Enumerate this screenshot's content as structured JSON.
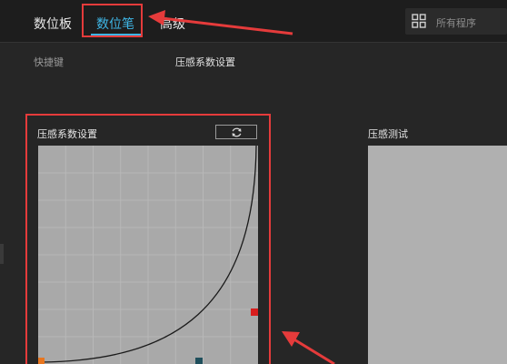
{
  "nav": {
    "tabs": [
      {
        "label": "数位板",
        "active": false
      },
      {
        "label": "数位笔",
        "active": true
      },
      {
        "label": "高级",
        "active": false
      }
    ]
  },
  "search": {
    "placeholder": "所有程序",
    "icon": "grid-icon"
  },
  "sub_tabs": {
    "shortcut": "快捷键",
    "pressure": "压感系数设置"
  },
  "pressure_panel": {
    "title": "压感系数设置",
    "reset_icon": "refresh-icon"
  },
  "pressure_test": {
    "title": "压感测试"
  },
  "colors": {
    "accent": "#3fb6e6",
    "annotation": "#e53b3b",
    "curve_bg": "#a9a9a9",
    "point_red": "#d81e1e",
    "point_orange": "#e8761f",
    "point_teal": "#1f4f5c"
  }
}
